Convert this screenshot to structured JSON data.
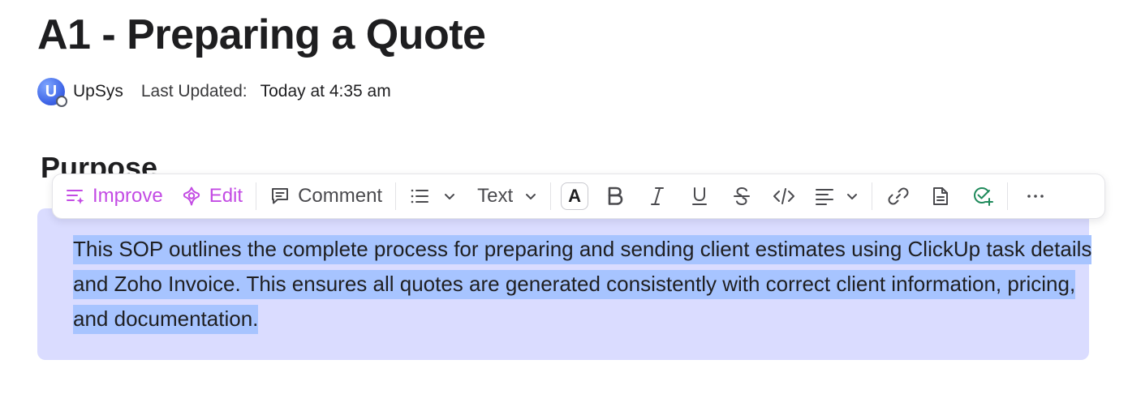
{
  "document": {
    "title": "A1 - Preparing a Quote",
    "author": "UpSys",
    "avatar_letter": "U",
    "last_updated_label": "Last Updated:",
    "last_updated_value": "Today at 4:35 am",
    "section_heading": "Purpose",
    "paragraph": "This SOP outlines the complete process for preparing and sending client estimates using ClickUp task details and Zoho Invoice. This ensures all quotes are generated consistently with correct client information, pricing, and documentation."
  },
  "toolbar": {
    "improve_label": "Improve",
    "edit_label": "Edit",
    "comment_label": "Comment",
    "text_style_label": "Text",
    "text_color_glyph": "A",
    "icons": [
      "improve-icon",
      "ai-edit-icon",
      "comment-icon",
      "bulleted-list-icon",
      "chevron-down-icon",
      "text-color-icon",
      "bold-icon",
      "italic-icon",
      "underline-icon",
      "strikethrough-icon",
      "code-icon",
      "align-left-icon",
      "link-icon",
      "page-icon",
      "create-task-icon",
      "more-icon"
    ]
  },
  "colors": {
    "accent_ai": "#c34be4",
    "selection_block": "#dadcff",
    "selection_text": "#a7c4ff",
    "task_green": "#1f8a5b"
  }
}
